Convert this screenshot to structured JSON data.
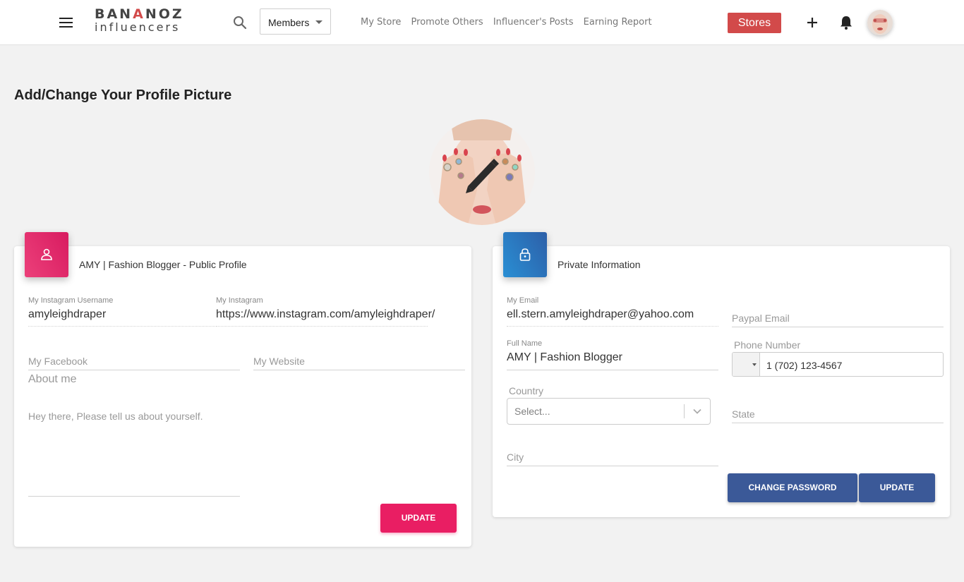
{
  "header": {
    "logo_top_a": "BAN",
    "logo_top_hl": "A",
    "logo_top_b": "NOZ",
    "logo_bottom": "influencers",
    "members_label": "Members",
    "nav": [
      "My Store",
      "Promote Others",
      "Influencer's Posts",
      "Earning Report"
    ],
    "stores_label": "Stores",
    "accent_color": "#d24a4a"
  },
  "page": {
    "title": "Add/Change Your Profile Picture"
  },
  "public_profile": {
    "title": "AMY | Fashion Blogger - Public Profile",
    "instagram_username_label": "My Instagram Username",
    "instagram_username_value": "amyleighdraper",
    "instagram_label": "My Instagram",
    "instagram_value": "https://www.instagram.com/amyleighdraper/",
    "facebook_placeholder": "My Facebook",
    "website_placeholder": "My Website",
    "about_label": "About me",
    "about_placeholder": "Hey there, Please tell us about yourself.",
    "update_label": "UPDATE",
    "badge_color": "#e91e63"
  },
  "private_info": {
    "title": "Private Information",
    "email_label": "My Email",
    "email_value": "ell.stern.amyleighdraper@yahoo.com",
    "paypal_placeholder": "Paypal Email",
    "fullname_label": "Full Name",
    "fullname_value": "AMY | Fashion Blogger",
    "phone_label": "Phone Number",
    "phone_value": "1 (702) 123-4567",
    "country_label": "Country",
    "country_placeholder": "Select...",
    "state_placeholder": "State",
    "city_placeholder": "City",
    "change_password_label": "CHANGE PASSWORD",
    "update_label": "UPDATE",
    "button_color": "#3b5998"
  },
  "icons": [
    "menu-icon",
    "search-icon",
    "caret-down-icon",
    "plus-icon",
    "bell-icon",
    "user-icon",
    "lock-icon",
    "pencil-icon",
    "chevron-down-icon"
  ]
}
